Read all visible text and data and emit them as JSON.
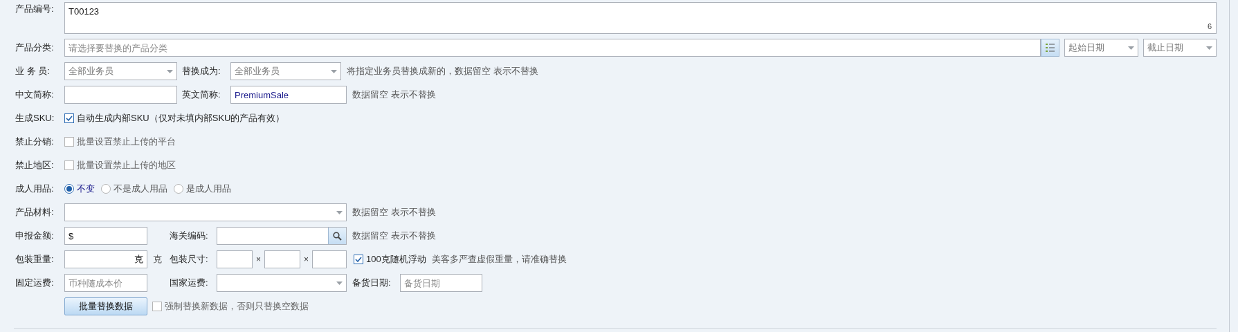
{
  "product_code": {
    "label": "产品编号:",
    "value": "T00123",
    "count": "6"
  },
  "category": {
    "label": "产品分类:",
    "placeholder": "请选择要替换的产品分类",
    "start_date": "起始日期",
    "end_date": "截止日期"
  },
  "salesperson": {
    "label": "业 务 员:",
    "value": "全部业务员",
    "replace_label": "替换成为:",
    "replace_value": "全部业务员",
    "hint": "将指定业务员替换成新的，数据留空 表示不替换"
  },
  "short_names": {
    "cn_label": "中文简称:",
    "en_label": "英文简称:",
    "en_value": "PremiumSale",
    "hint": "数据留空 表示不替换"
  },
  "sku": {
    "label": "生成SKU:",
    "text": "自动生成内部SKU（仅对未填内部SKU的产品有效）",
    "checked": true
  },
  "distribution": {
    "label": "禁止分销:",
    "text": "批量设置禁止上传的平台",
    "checked": false
  },
  "region": {
    "label": "禁止地区:",
    "text": "批量设置禁止上传的地区",
    "checked": false
  },
  "adult": {
    "label": "成人用品:",
    "options": [
      {
        "text": "不变",
        "selected": true
      },
      {
        "text": "不是成人用品",
        "selected": false
      },
      {
        "text": "是成人用品",
        "selected": false
      }
    ]
  },
  "material": {
    "label": "产品材料:",
    "hint": "数据留空 表示不替换"
  },
  "declared": {
    "label": "申报金额:",
    "value": "$",
    "customs_label": "海关编码:",
    "hint": "数据留空 表示不替换"
  },
  "package": {
    "label": "包装重量:",
    "weight_value": "克",
    "unit": "克",
    "size_label": "包装尺寸:",
    "separators": [
      "×",
      "×"
    ],
    "float_text": "100克随机浮动",
    "float_checked": true,
    "hint": "美客多严查虚假重量，请准确替换"
  },
  "fees": {
    "label": "固定运费:",
    "placeholder": "币种随成本价",
    "country_label": "国家运费:",
    "stock_label": "备货日期:",
    "stock_placeholder": "备货日期"
  },
  "submit": {
    "label": "批量替换数据",
    "force_text": "强制替换新数据，否则只替换空数据",
    "force_checked": false
  }
}
